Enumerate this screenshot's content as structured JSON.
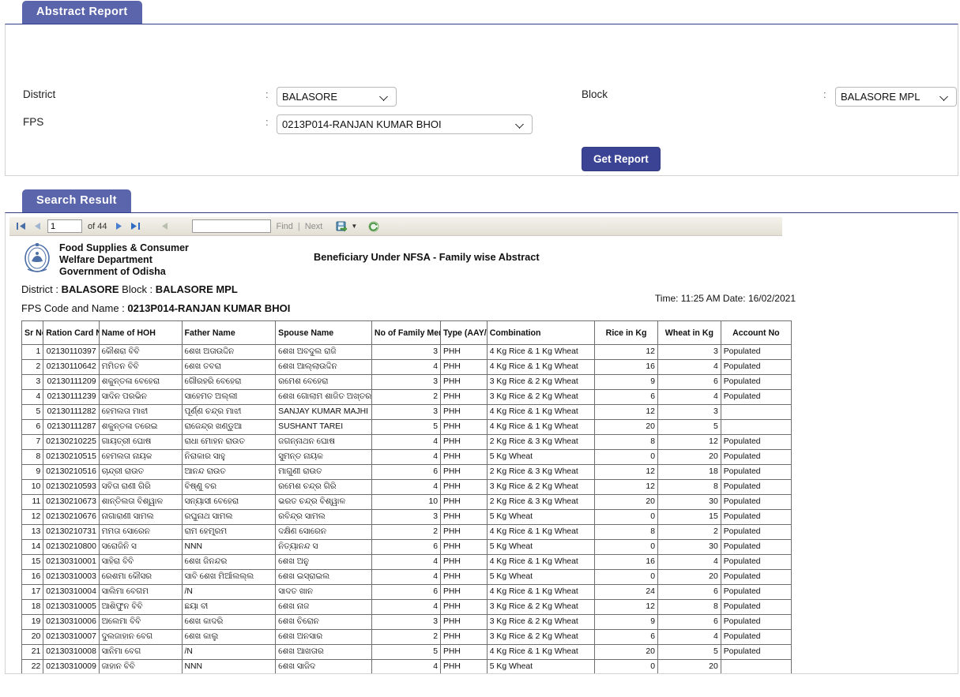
{
  "filter_panel": {
    "tab_label": "Abstract Report",
    "fields": {
      "district_label": "District",
      "district_value": "BALASORE",
      "block_label": "Block",
      "block_value": "BALASORE MPL",
      "fps_label": "FPS",
      "fps_value": "0213P014-RANJAN KUMAR BHOI",
      "separator": ":"
    },
    "get_report_label": "Get Report"
  },
  "result_panel": {
    "tab_label": "Search Result",
    "toolbar": {
      "page_value": "1",
      "of_label": "of 44",
      "find_value": "",
      "find_label": "Find",
      "separator": "|",
      "next_label": "Next"
    },
    "report": {
      "department_line1": "Food Supplies & Consumer",
      "department_line2": "Welfare Department",
      "department_line3": "Government of Odisha",
      "title": "Beneficiary Under NFSA  - Family wise Abstract",
      "district_label": "District :",
      "district_value": "BALASORE",
      "block_label": "Block :",
      "block_value": "BALASORE MPL",
      "fps_label": "FPS Code and Name :",
      "fps_value": "0213P014-RANJAN KUMAR BHOI",
      "time_date": "Time: 11:25 AM  Date: 16/02/2021",
      "columns": [
        "Sr No",
        "Ration Card No",
        "Name of HOH",
        "Father Name",
        "Spouse Name",
        "No of Family Members",
        "Type (AAY/PHH)",
        "Combination",
        "Rice in Kg",
        "Wheat in Kg",
        "Account No"
      ],
      "rows": [
        {
          "sr": "1",
          "ration_card": "02130110397",
          "hoh": "କୌଶରା ବିବି",
          "father": "ଶେଖ ଅତାଉଦ୍ଦିନ",
          "spouse": "ଶେଖ ଅବଦୁଲ ରାଜି",
          "family": "3",
          "type": "PHH",
          "combination": "4 Kg Rice & 1 Kg Wheat",
          "rice": "12",
          "wheat": "3",
          "account": "Populated"
        },
        {
          "sr": "2",
          "ration_card": "02130110642",
          "hoh": "ମମିତନ ବିବି",
          "father": "ଶେଖ ତବରା",
          "spouse": "ଶେଖ ଆଲ୍ଲାଉଦ୍ଦିନ",
          "family": "4",
          "type": "PHH",
          "combination": "4 Kg Rice & 1 Kg Wheat",
          "rice": "16",
          "wheat": "4",
          "account": "Populated"
        },
        {
          "sr": "3",
          "ration_card": "02130111209",
          "hoh": "ଶକୁନ୍ତଳା ବେହେରା",
          "father": "ଗୌରହରି ବେହେରା",
          "spouse": "ରମେଶ  ବେହେରା",
          "family": "3",
          "type": "PHH",
          "combination": "3 Kg Rice & 2 Kg Wheat",
          "rice": "9",
          "wheat": "6",
          "account": "Populated"
        },
        {
          "sr": "4",
          "ration_card": "02130111239",
          "hoh": "ସାଦିନ ପରଭିନ",
          "father": "ସାହେମତ ଅଲ୍ଲୀ",
          "spouse": "ଶେଖ ଗୋଲାମ ଶାଜିତ ଅଖ୍ତର",
          "family": "2",
          "type": "PHH",
          "combination": "3 Kg Rice & 2 Kg Wheat",
          "rice": "6",
          "wheat": "4",
          "account": "Populated"
        },
        {
          "sr": "5",
          "ration_card": "02130111282",
          "hoh": "ହେମଲତା ମାଝୀ",
          "father": "ପୂର୍ଣ୍ଣ ଚନ୍ଦ୍ର ମାଝୀ",
          "spouse": "SANJAY KUMAR MAJHI",
          "family": "3",
          "type": "PHH",
          "combination": "4 Kg Rice & 1 Kg Wheat",
          "rice": "12",
          "wheat": "3",
          "account": ""
        },
        {
          "sr": "6",
          "ration_card": "02130111287",
          "hoh": "ଶକୁନ୍ତଳା   ତରେଇ",
          "father": "ରାଜେନ୍ଦ୍ର ଖଣ୍ଡୁଆ",
          "spouse": "SUSHANT  TAREI",
          "family": "5",
          "type": "PHH",
          "combination": "4 Kg Rice & 1 Kg Wheat",
          "rice": "20",
          "wheat": "5",
          "account": ""
        },
        {
          "sr": "7",
          "ration_card": "02130210225",
          "hoh": "ଗାୟତ୍ରୀ ଘୋଷ",
          "father": "ରାଧା ମୋହନ ରାଉତ",
          "spouse": "ଜଗନ୍ନାଥନ  ଘୋଷ",
          "family": "4",
          "type": "PHH",
          "combination": "2 Kg Rice & 3 Kg Wheat",
          "rice": "8",
          "wheat": "12",
          "account": "Populated"
        },
        {
          "sr": "8",
          "ration_card": "02130210515",
          "hoh": "ହେମଲତା ନାୟକ",
          "father": "ନିରାକାର ସାହୁ",
          "spouse": "ସୁମନ୍ତ ନାୟକ",
          "family": "4",
          "type": "PHH",
          "combination": "5 Kg Wheat",
          "rice": "0",
          "wheat": "20",
          "account": "Populated"
        },
        {
          "sr": "9",
          "ration_card": "02130210516",
          "hoh": "ଚାନ୍ଦ୍ରୀ ରାଉତ",
          "father": "ଆନନ୍ଦ ରାଉତ",
          "spouse": "ମାଗୁଣୀ ରାଉତ",
          "family": "6",
          "type": "PHH",
          "combination": "2 Kg Rice & 3 Kg Wheat",
          "rice": "12",
          "wheat": "18",
          "account": "Populated"
        },
        {
          "sr": "10",
          "ration_card": "02130210593",
          "hoh": "ସବିତା ରାଣୀ ଗିରି",
          "father": "ବିଷ୍ଣୁ ବର",
          "spouse": "ରମେଶ ଚନ୍ଦ୍ର ଗିରି",
          "family": "4",
          "type": "PHH",
          "combination": "3 Kg Rice & 2 Kg Wheat",
          "rice": "12",
          "wheat": "8",
          "account": "Populated"
        },
        {
          "sr": "11",
          "ration_card": "02130210673",
          "hoh": "ଶାନ୍ତିଲତା ବିଶ୍ୱାଳ",
          "father": "ସନ୍ୟାସୀ ବେହେରା",
          "spouse": "ଭରତ ଚନ୍ଦ୍ର ବିଶ୍ୱାଳ",
          "family": "10",
          "type": "PHH",
          "combination": "2 Kg Rice & 3 Kg Wheat",
          "rice": "20",
          "wheat": "30",
          "account": "Populated"
        },
        {
          "sr": "12",
          "ration_card": "02130210676",
          "hoh": "ନାଗାରାଣୀ  ସାମଲ",
          "father": "ରଘୁନାଥ ସାମଲ",
          "spouse": "ରବିନ୍ଦ୍ର ସାମଲ",
          "family": "3",
          "type": "PHH",
          "combination": "5 Kg Wheat",
          "rice": "0",
          "wheat": "15",
          "account": "Populated"
        },
        {
          "sr": "13",
          "ration_card": "02130210731",
          "hoh": "ମମତା ସୋରେନ",
          "father": "ରାମ ହେମ୍ବ୍ରମ",
          "spouse": "ଦକ୍ଷିଣ ସୋରେନ",
          "family": "2",
          "type": "PHH",
          "combination": "4 Kg Rice & 1 Kg Wheat",
          "rice": "8",
          "wheat": "2",
          "account": "Populated"
        },
        {
          "sr": "14",
          "ration_card": "02130210800",
          "hoh": "ସରୋଜିନି ସ",
          "father": "NNN",
          "spouse": "ନିତ୍ୟାନନ୍ଦ ସ",
          "family": "6",
          "type": "PHH",
          "combination": "5 Kg Wheat",
          "rice": "0",
          "wheat": "30",
          "account": "Populated"
        },
        {
          "sr": "15",
          "ration_card": "02130310001",
          "hoh": "ସାହିରା ବିବି",
          "father": "ଶେଖ ଜିନନ୍ଦର",
          "spouse": "ଶେଖ ଅନୁ",
          "family": "4",
          "type": "PHH",
          "combination": "4 Kg Rice & 1 Kg Wheat",
          "rice": "16",
          "wheat": "4",
          "account": "Populated"
        },
        {
          "sr": "16",
          "ration_card": "02130310003",
          "hoh": "ରେଶମା କୌସର",
          "father": "ସାବି ଶେଖ ମିଆଁଲଲ୍ଲ",
          "spouse": "ଶେଖ ଇସ୍ରାଇଲ",
          "family": "4",
          "type": "PHH",
          "combination": "5 Kg Wheat",
          "rice": "0",
          "wheat": "20",
          "account": "Populated"
        },
        {
          "sr": "17",
          "ration_card": "02130310004",
          "hoh": "ସାଲିମା ବେଗମ",
          "father": "/N",
          "spouse": "ସାଦତ ଖାନ",
          "family": "6",
          "type": "PHH",
          "combination": "4 Kg Rice & 1 Kg Wheat",
          "rice": "24",
          "wheat": "6",
          "account": "Populated"
        },
        {
          "sr": "18",
          "ration_card": "02130310005",
          "hoh": "ଆଶିଫୁନ ବିବି",
          "father": "ଛୟା ବୀ",
          "spouse": "ଶେଖ ନାଜ",
          "family": "4",
          "type": "PHH",
          "combination": "3 Kg Rice & 2 Kg Wheat",
          "rice": "12",
          "wheat": "8",
          "account": "Populated"
        },
        {
          "sr": "19",
          "ration_card": "02130310006",
          "hoh": "ଅଲେମା ବିବି",
          "father": "ଶେଖ କାଦରି",
          "spouse": "ଶେଖ ଚିରୋନ",
          "family": "3",
          "type": "PHH",
          "combination": "3 Kg Rice & 2 Kg Wheat",
          "rice": "9",
          "wheat": "6",
          "account": "Populated"
        },
        {
          "sr": "20",
          "ration_card": "02130310007",
          "hoh": "ଦୁଲଜାହାନ ବେଗ",
          "father": "ଶେଖ କାଲୁ",
          "spouse": "ଶେଖ ଅନସାର",
          "family": "2",
          "type": "PHH",
          "combination": "3 Kg Rice & 2 Kg Wheat",
          "rice": "6",
          "wheat": "4",
          "account": "Populated"
        },
        {
          "sr": "21",
          "ration_card": "02130310008",
          "hoh": "ସାନିମା ବେଗ",
          "father": "/N",
          "spouse": "ଶେଖ ଆଖତାର",
          "family": "5",
          "type": "PHH",
          "combination": "4 Kg Rice & 1 Kg Wheat",
          "rice": "20",
          "wheat": "5",
          "account": "Populated"
        },
        {
          "sr": "22",
          "ration_card": "02130310009",
          "hoh": "ଜାହାନ ବିବି",
          "father": "NNN",
          "spouse": "ଶେଖ ସାଜିଦ",
          "family": "4",
          "type": "PHH",
          "combination": "5 Kg Wheat",
          "rice": "0",
          "wheat": "20",
          "account": ""
        }
      ]
    }
  },
  "colors": {
    "tab_bg": "#5b65ab",
    "button_bg": "#3b4395",
    "ration_card_text": "#2a3f9d"
  }
}
